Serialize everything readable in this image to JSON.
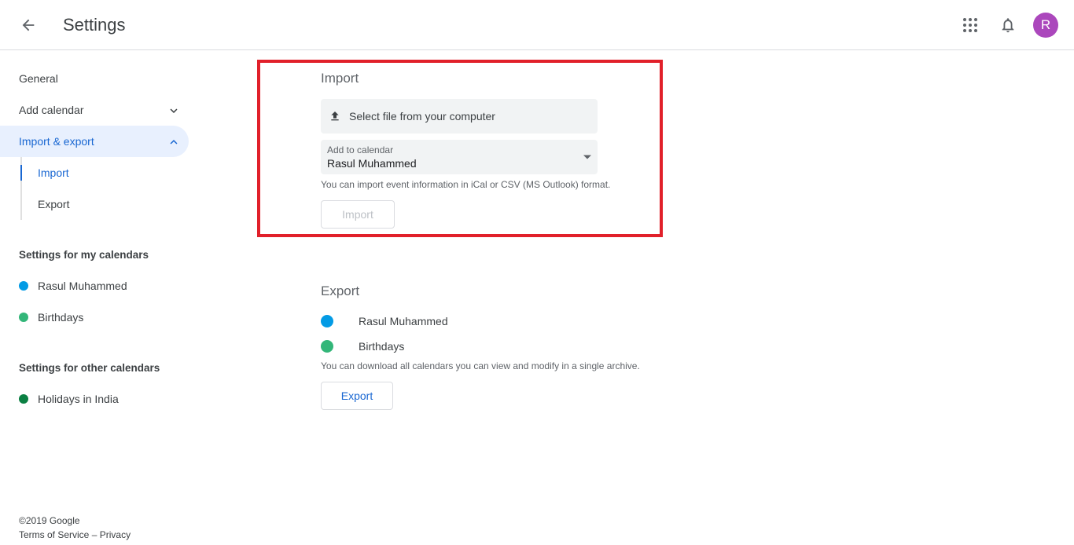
{
  "header": {
    "title": "Settings",
    "avatar_letter": "R"
  },
  "sidebar": {
    "general": "General",
    "add_calendar": "Add calendar",
    "import_export": "Import & export",
    "sub_import": "Import",
    "sub_export": "Export",
    "my_calendars_heading": "Settings for my calendars",
    "my_calendars": [
      {
        "label": "Rasul Muhammed",
        "color": "#039be5"
      },
      {
        "label": "Birthdays",
        "color": "#33b679"
      }
    ],
    "other_calendars_heading": "Settings for other calendars",
    "other_calendars": [
      {
        "label": "Holidays in India",
        "color": "#0b8043"
      }
    ]
  },
  "import_section": {
    "title": "Import",
    "select_file": "Select file from your computer",
    "add_to_calendar_label": "Add to calendar",
    "add_to_calendar_value": "Rasul Muhammed",
    "help": "You can import event information in iCal or CSV (MS Outlook) format.",
    "button": "Import"
  },
  "export_section": {
    "title": "Export",
    "calendars": [
      {
        "label": "Rasul Muhammed",
        "color": "#039be5"
      },
      {
        "label": "Birthdays",
        "color": "#33b679"
      }
    ],
    "help": "You can download all calendars you can view and modify in a single archive.",
    "button": "Export"
  },
  "footer": {
    "copyright": "©2019 Google",
    "terms": "Terms of Service",
    "separator": "–",
    "privacy": "Privacy"
  },
  "colors": {
    "accent": "#1967d2",
    "highlight_box": "#e1202a",
    "avatar": "#ab47bc"
  }
}
